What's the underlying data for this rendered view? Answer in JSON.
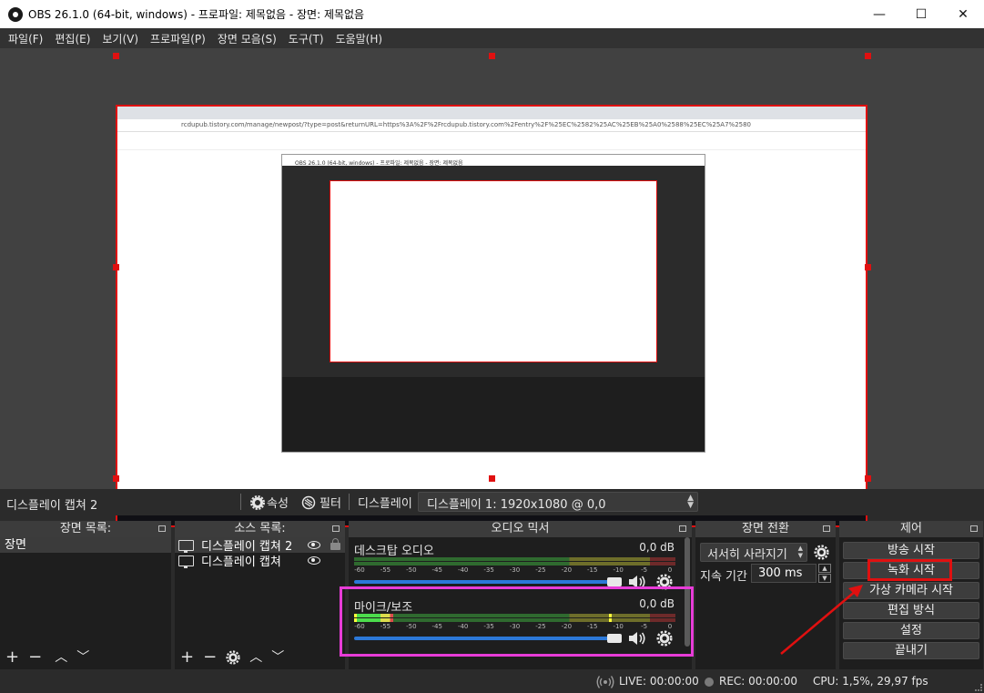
{
  "window": {
    "title": "OBS 26.1.0 (64-bit, windows) - 프로파일: 제목없음 - 장면: 제목없음",
    "minimize": "—",
    "maximize": "☐",
    "close": "✕"
  },
  "menu": {
    "items": [
      {
        "label": "파일(F)"
      },
      {
        "label": "편집(E)"
      },
      {
        "label": "보기(V)"
      },
      {
        "label": "프로파일(P)"
      },
      {
        "label": "장면 모음(S)"
      },
      {
        "label": "도구(T)"
      },
      {
        "label": "도움말(H)"
      }
    ]
  },
  "preview": {
    "address": "rcdupub.tistory.com/manage/newpost/?type=post&returnURL=https%3A%2F%2Frcdupub.tistory.com%2Fentry%2F%25EC%2582%25AC%25EB%25A0%2588%25EC%25A7%2580",
    "nested_title": "OBS 26.1.0 (64-bit, windows) - 프로파일: 제목없음 - 장면: 제목없음"
  },
  "source_toolbar": {
    "selected_source": "디스플레이 캡쳐 2",
    "properties_label": "속성",
    "filters_label": "필터",
    "display_label": "디스플레이",
    "display_value": "디스플레이 1: 1920x1080 @ 0,0"
  },
  "scenes": {
    "header": "장면 목록:",
    "items": [
      "장면"
    ]
  },
  "sources": {
    "header": "소스 목록:",
    "items": [
      {
        "label": "디스플레이 캡쳐 2"
      },
      {
        "label": "디스플레이 캡쳐"
      }
    ]
  },
  "mixer": {
    "header": "오디오 믹서",
    "channels": [
      {
        "name": "데스크탑 오디오",
        "db": "0,0 dB",
        "level": 0,
        "volume": 1.0
      },
      {
        "name": "마이크/보조",
        "db": "0,0 dB",
        "level": 0.12,
        "volume": 1.0
      }
    ],
    "scale": [
      "-60",
      "-55",
      "-50",
      "-45",
      "-40",
      "-35",
      "-30",
      "-25",
      "-20",
      "-15",
      "-10",
      "-5",
      "0"
    ]
  },
  "transitions": {
    "header": "장면 전환",
    "selected": "서서히 사라지기",
    "duration_label": "지속 기간",
    "duration_value": "300 ms"
  },
  "controls": {
    "header": "제어",
    "buttons": [
      {
        "label": "방송 시작"
      },
      {
        "label": "녹화 시작"
      },
      {
        "label": "가상 카메라 시작"
      },
      {
        "label": "편집 방식"
      },
      {
        "label": "설정"
      },
      {
        "label": "끝내기"
      }
    ]
  },
  "status": {
    "live": "LIVE: 00:00:00",
    "rec": "REC: 00:00:00",
    "cpu": "CPU: 1,5%, 29,97 fps"
  },
  "colors": {
    "accent_blue": "#2c78d8",
    "highlight_magenta": "#e83cd8",
    "highlight_red": "#e01010"
  }
}
